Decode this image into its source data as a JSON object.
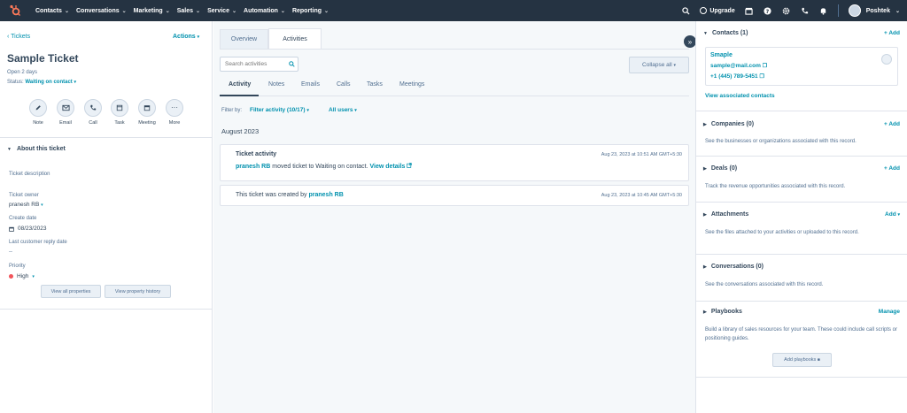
{
  "nav": {
    "items": [
      "Contacts",
      "Conversations",
      "Marketing",
      "Sales",
      "Service",
      "Automation",
      "Reporting"
    ],
    "upgrade": "Upgrade",
    "account": "Poshtek"
  },
  "left": {
    "back": "Tickets",
    "actions": "Actions",
    "title": "Sample Ticket",
    "open_for": "Open 2 days",
    "status_label": "Status:",
    "status_value": "Waiting on contact",
    "actions_list": [
      "Note",
      "Email",
      "Call",
      "Task",
      "Meeting",
      "More"
    ],
    "about_header": "About this ticket",
    "fields": {
      "desc_label": "Ticket description",
      "owner_label": "Ticket owner",
      "owner_value": "pranesh RB",
      "create_label": "Create date",
      "create_value": "08/23/2023",
      "reply_label": "Last customer reply date",
      "reply_value": "--",
      "priority_label": "Priority",
      "priority_value": "High"
    },
    "view_all": "View all properties",
    "view_history": "View property history"
  },
  "mid": {
    "tabs": [
      "Overview",
      "Activities"
    ],
    "search_placeholder": "Search activities",
    "collapse": "Collapse all",
    "subtabs": [
      "Activity",
      "Notes",
      "Emails",
      "Calls",
      "Tasks",
      "Meetings"
    ],
    "filter_by": "Filter by:",
    "filter_activity": "Filter activity (10/17)",
    "all_users": "All users",
    "month": "August 2023",
    "card1": {
      "title": "Ticket activity",
      "time": "Aug 23, 2023 at 10:51 AM GMT+5:30",
      "user": "pranesh RB",
      "text": "moved ticket to Waiting on contact.",
      "link": "View details"
    },
    "card2": {
      "text": "This ticket was created by",
      "user": "pranesh RB",
      "time": "Aug 23, 2023 at 10:45 AM GMT+5:30"
    }
  },
  "right": {
    "contacts": {
      "title": "Contacts (1)",
      "add": "+ Add",
      "name": "Smaple",
      "email": "sample@mail.com",
      "phone": "+1 (445) 789-5451",
      "view": "View associated contacts"
    },
    "companies": {
      "title": "Companies (0)",
      "add": "+ Add",
      "text": "See the businesses or organizations associated with this record."
    },
    "deals": {
      "title": "Deals (0)",
      "add": "+ Add",
      "text": "Track the revenue opportunities associated with this record."
    },
    "attachments": {
      "title": "Attachments",
      "add": "Add",
      "text": "See the files attached to your activities or uploaded to this record."
    },
    "conversations": {
      "title": "Conversations (0)",
      "text": "See the conversations associated with this record."
    },
    "playbooks": {
      "title": "Playbooks",
      "manage": "Manage",
      "text": "Build a library of sales resources for your team. These could include call scripts or positioning guides.",
      "button": "Add playbooks"
    }
  },
  "colors": {
    "nav_bg": "#253342",
    "link": "#0091ae",
    "brand": "#ff7a59",
    "priority": "#f2545b"
  }
}
